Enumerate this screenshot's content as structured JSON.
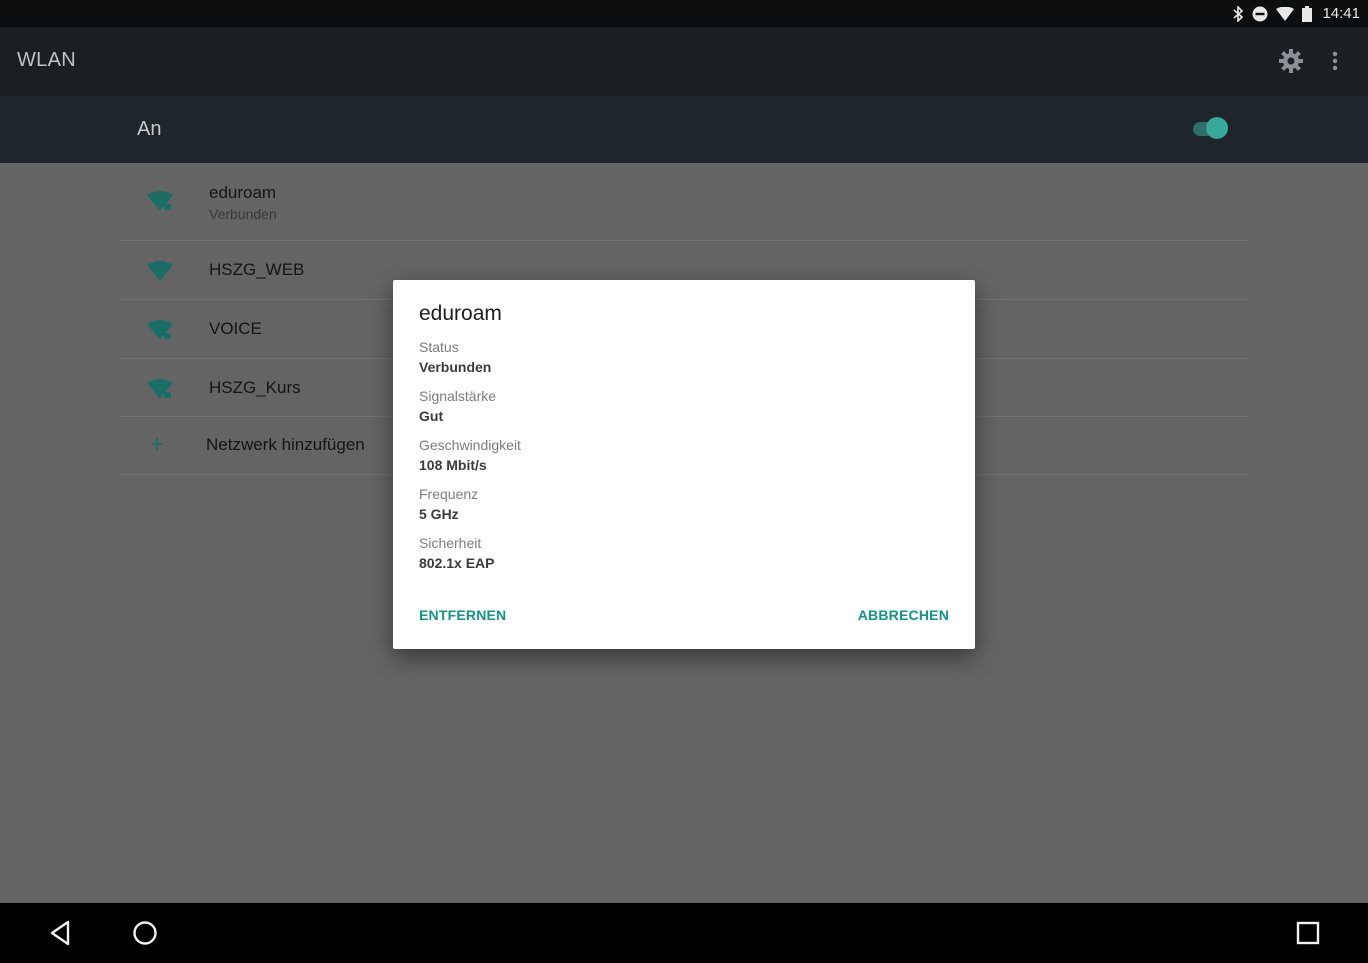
{
  "status_bar": {
    "time": "14:41",
    "icons": [
      "bluetooth-icon",
      "do-not-disturb-icon",
      "wifi-icon",
      "battery-icon"
    ]
  },
  "app_bar": {
    "title": "WLAN",
    "actions": [
      "gear-icon",
      "more-vert-icon"
    ]
  },
  "switch_bar": {
    "label": "An",
    "enabled": true
  },
  "networks": [
    {
      "name": "eduroam",
      "status": "Verbunden",
      "icon": "wifi-lock-icon"
    },
    {
      "name": "HSZG_WEB",
      "status": "",
      "icon": "wifi-icon"
    },
    {
      "name": "VOICE",
      "status": "",
      "icon": "wifi-lock-icon"
    },
    {
      "name": "HSZG_Kurs",
      "status": "",
      "icon": "wifi-lock-icon"
    }
  ],
  "add_network": {
    "label": "Netzwerk hinzufügen",
    "icon": "plus-icon"
  },
  "dialog": {
    "title": "eduroam",
    "fields": [
      {
        "label": "Status",
        "value": "Verbunden"
      },
      {
        "label": "Signalstärke",
        "value": "Gut"
      },
      {
        "label": "Geschwindigkeit",
        "value": "108 Mbit/s"
      },
      {
        "label": "Frequenz",
        "value": "5 GHz"
      },
      {
        "label": "Sicherheit",
        "value": "802.1x EAP"
      }
    ],
    "remove_label": "ENTFERNEN",
    "cancel_label": "ABBRECHEN"
  },
  "nav_bar": {
    "buttons": [
      "back-icon",
      "home-icon",
      "recents-icon"
    ]
  },
  "colors": {
    "accent": "#109586",
    "scrim": "#646464",
    "app_bar": "#1a1f23",
    "switch_bar": "#1e262b"
  }
}
